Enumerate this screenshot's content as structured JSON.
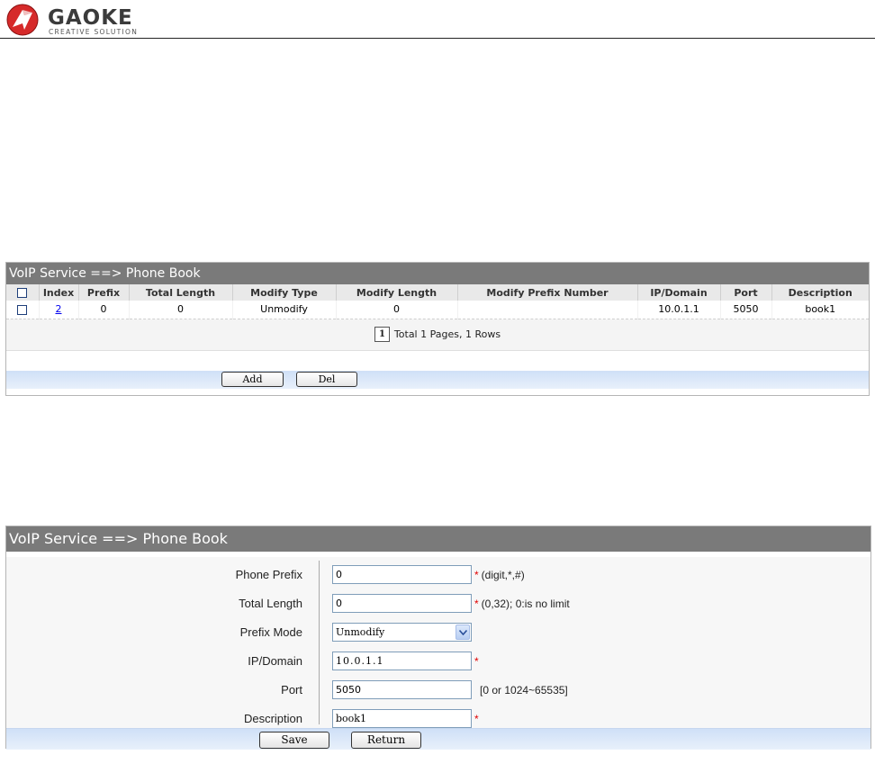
{
  "brand": {
    "name": "GAOKE",
    "tagline": "CREATIVE SOLUTION",
    "accent": "#d62a2a"
  },
  "list_panel": {
    "title": "VoIP Service ==> Phone Book",
    "columns": [
      "Index",
      "Prefix",
      "Total Length",
      "Modify Type",
      "Modify Length",
      "Modify Prefix Number",
      "IP/Domain",
      "Port",
      "Description"
    ],
    "rows": [
      {
        "index": "2",
        "prefix": "0",
        "total_length": "0",
        "modify_type": "Unmodify",
        "modify_length": "0",
        "modify_prefix_number": "",
        "ip_domain": "10.0.1.1",
        "port": "5050",
        "description": "book1"
      }
    ],
    "pager": {
      "current_page": "1",
      "summary": "Total 1 Pages, 1 Rows"
    },
    "buttons": {
      "add": "Add",
      "del": "Del"
    }
  },
  "form_panel": {
    "title": "VoIP Service ==> Phone Book",
    "fields": {
      "phone_prefix": {
        "label": "Phone Prefix",
        "value": "0",
        "required": "*",
        "hint": "(digit,*,#)"
      },
      "total_length": {
        "label": "Total Length",
        "value": "0",
        "required": "*",
        "hint": "(0,32); 0:is no limit"
      },
      "prefix_mode": {
        "label": "Prefix Mode",
        "value": "Unmodify"
      },
      "ip_domain": {
        "label": "IP/Domain",
        "value": "10.0.1.1",
        "required": "*"
      },
      "port": {
        "label": "Port",
        "value": "5050",
        "hint": "[0 or 1024~65535]"
      },
      "description": {
        "label": "Description",
        "value": "book1",
        "required": "*"
      }
    },
    "buttons": {
      "save": "Save",
      "return": "Return"
    }
  }
}
